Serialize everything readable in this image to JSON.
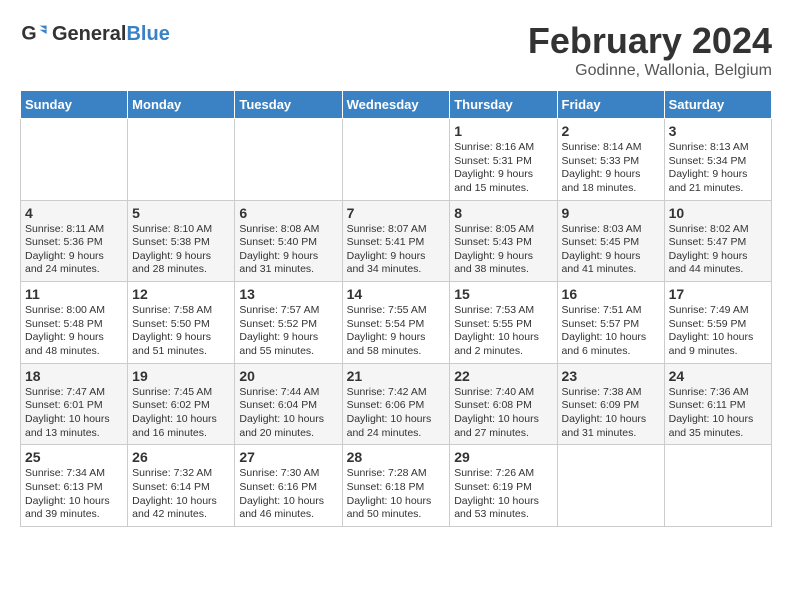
{
  "logo": {
    "text_general": "General",
    "text_blue": "Blue"
  },
  "title": "February 2024",
  "subtitle": "Godinne, Wallonia, Belgium",
  "days_of_week": [
    "Sunday",
    "Monday",
    "Tuesday",
    "Wednesday",
    "Thursday",
    "Friday",
    "Saturday"
  ],
  "weeks": [
    [
      {
        "day": "",
        "info": ""
      },
      {
        "day": "",
        "info": ""
      },
      {
        "day": "",
        "info": ""
      },
      {
        "day": "",
        "info": ""
      },
      {
        "day": "1",
        "info": "Sunrise: 8:16 AM\nSunset: 5:31 PM\nDaylight: 9 hours and 15 minutes."
      },
      {
        "day": "2",
        "info": "Sunrise: 8:14 AM\nSunset: 5:33 PM\nDaylight: 9 hours and 18 minutes."
      },
      {
        "day": "3",
        "info": "Sunrise: 8:13 AM\nSunset: 5:34 PM\nDaylight: 9 hours and 21 minutes."
      }
    ],
    [
      {
        "day": "4",
        "info": "Sunrise: 8:11 AM\nSunset: 5:36 PM\nDaylight: 9 hours and 24 minutes."
      },
      {
        "day": "5",
        "info": "Sunrise: 8:10 AM\nSunset: 5:38 PM\nDaylight: 9 hours and 28 minutes."
      },
      {
        "day": "6",
        "info": "Sunrise: 8:08 AM\nSunset: 5:40 PM\nDaylight: 9 hours and 31 minutes."
      },
      {
        "day": "7",
        "info": "Sunrise: 8:07 AM\nSunset: 5:41 PM\nDaylight: 9 hours and 34 minutes."
      },
      {
        "day": "8",
        "info": "Sunrise: 8:05 AM\nSunset: 5:43 PM\nDaylight: 9 hours and 38 minutes."
      },
      {
        "day": "9",
        "info": "Sunrise: 8:03 AM\nSunset: 5:45 PM\nDaylight: 9 hours and 41 minutes."
      },
      {
        "day": "10",
        "info": "Sunrise: 8:02 AM\nSunset: 5:47 PM\nDaylight: 9 hours and 44 minutes."
      }
    ],
    [
      {
        "day": "11",
        "info": "Sunrise: 8:00 AM\nSunset: 5:48 PM\nDaylight: 9 hours and 48 minutes."
      },
      {
        "day": "12",
        "info": "Sunrise: 7:58 AM\nSunset: 5:50 PM\nDaylight: 9 hours and 51 minutes."
      },
      {
        "day": "13",
        "info": "Sunrise: 7:57 AM\nSunset: 5:52 PM\nDaylight: 9 hours and 55 minutes."
      },
      {
        "day": "14",
        "info": "Sunrise: 7:55 AM\nSunset: 5:54 PM\nDaylight: 9 hours and 58 minutes."
      },
      {
        "day": "15",
        "info": "Sunrise: 7:53 AM\nSunset: 5:55 PM\nDaylight: 10 hours and 2 minutes."
      },
      {
        "day": "16",
        "info": "Sunrise: 7:51 AM\nSunset: 5:57 PM\nDaylight: 10 hours and 6 minutes."
      },
      {
        "day": "17",
        "info": "Sunrise: 7:49 AM\nSunset: 5:59 PM\nDaylight: 10 hours and 9 minutes."
      }
    ],
    [
      {
        "day": "18",
        "info": "Sunrise: 7:47 AM\nSunset: 6:01 PM\nDaylight: 10 hours and 13 minutes."
      },
      {
        "day": "19",
        "info": "Sunrise: 7:45 AM\nSunset: 6:02 PM\nDaylight: 10 hours and 16 minutes."
      },
      {
        "day": "20",
        "info": "Sunrise: 7:44 AM\nSunset: 6:04 PM\nDaylight: 10 hours and 20 minutes."
      },
      {
        "day": "21",
        "info": "Sunrise: 7:42 AM\nSunset: 6:06 PM\nDaylight: 10 hours and 24 minutes."
      },
      {
        "day": "22",
        "info": "Sunrise: 7:40 AM\nSunset: 6:08 PM\nDaylight: 10 hours and 27 minutes."
      },
      {
        "day": "23",
        "info": "Sunrise: 7:38 AM\nSunset: 6:09 PM\nDaylight: 10 hours and 31 minutes."
      },
      {
        "day": "24",
        "info": "Sunrise: 7:36 AM\nSunset: 6:11 PM\nDaylight: 10 hours and 35 minutes."
      }
    ],
    [
      {
        "day": "25",
        "info": "Sunrise: 7:34 AM\nSunset: 6:13 PM\nDaylight: 10 hours and 39 minutes."
      },
      {
        "day": "26",
        "info": "Sunrise: 7:32 AM\nSunset: 6:14 PM\nDaylight: 10 hours and 42 minutes."
      },
      {
        "day": "27",
        "info": "Sunrise: 7:30 AM\nSunset: 6:16 PM\nDaylight: 10 hours and 46 minutes."
      },
      {
        "day": "28",
        "info": "Sunrise: 7:28 AM\nSunset: 6:18 PM\nDaylight: 10 hours and 50 minutes."
      },
      {
        "day": "29",
        "info": "Sunrise: 7:26 AM\nSunset: 6:19 PM\nDaylight: 10 hours and 53 minutes."
      },
      {
        "day": "",
        "info": ""
      },
      {
        "day": "",
        "info": ""
      }
    ]
  ]
}
